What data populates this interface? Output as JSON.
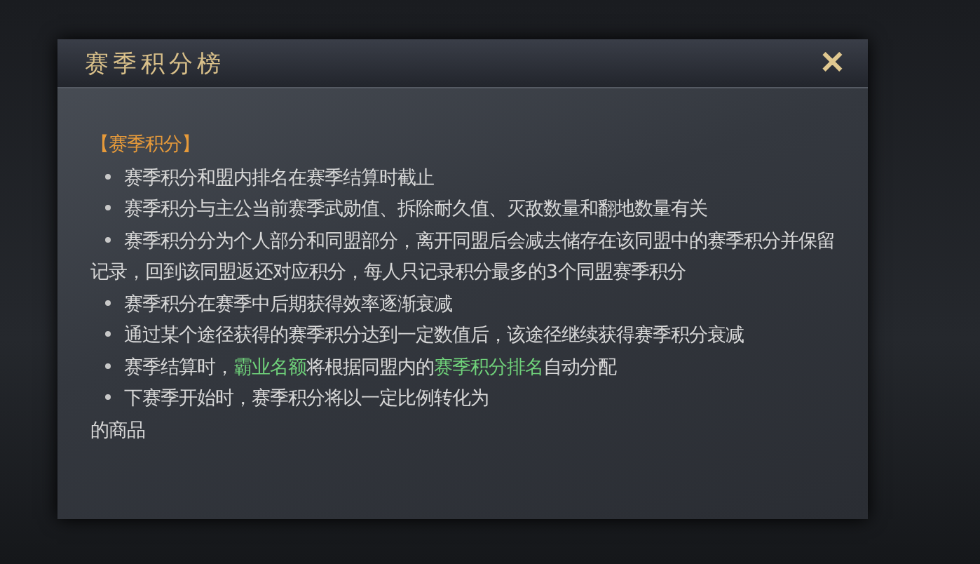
{
  "dialog": {
    "title": "赛季积分榜",
    "close_icon": "✕"
  },
  "section": {
    "heading": "【赛季积分】",
    "items": [
      {
        "segments": [
          {
            "text": "赛季积分和盟内排名在赛季结算时截止",
            "highlight": false
          }
        ]
      },
      {
        "segments": [
          {
            "text": "赛季积分与主公当前赛季武勋值、拆除耐久值、灭敌数量和翻地数量有关",
            "highlight": false
          }
        ]
      },
      {
        "segments": [
          {
            "text": "赛季积分分为个人部分和同盟部分，离开同盟后会减去储存在该同盟中的赛季积分并保留记录，回到该同盟返还对应积分，每人只记录积分最多的3个同盟赛季积分",
            "highlight": false
          }
        ]
      },
      {
        "segments": [
          {
            "text": "赛季积分在赛季中后期获得效率逐渐衰减",
            "highlight": false
          }
        ]
      },
      {
        "segments": [
          {
            "text": "通过某个途径获得的赛季积分达到一定数值后，该途径继续获得赛季积分衰减",
            "highlight": false
          }
        ]
      },
      {
        "segments": [
          {
            "text": "赛季结算时，",
            "highlight": false
          },
          {
            "text": "霸业名额",
            "highlight": true
          },
          {
            "text": "将根据同盟内的",
            "highlight": false
          },
          {
            "text": "赛季积分排名",
            "highlight": true
          },
          {
            "text": "自动分配",
            "highlight": false
          }
        ]
      },
      {
        "segments": [
          {
            "text": "下赛季开始时，赛季积分将以一定比例转化为",
            "highlight": false
          }
        ],
        "continuation": "的商品"
      }
    ]
  }
}
